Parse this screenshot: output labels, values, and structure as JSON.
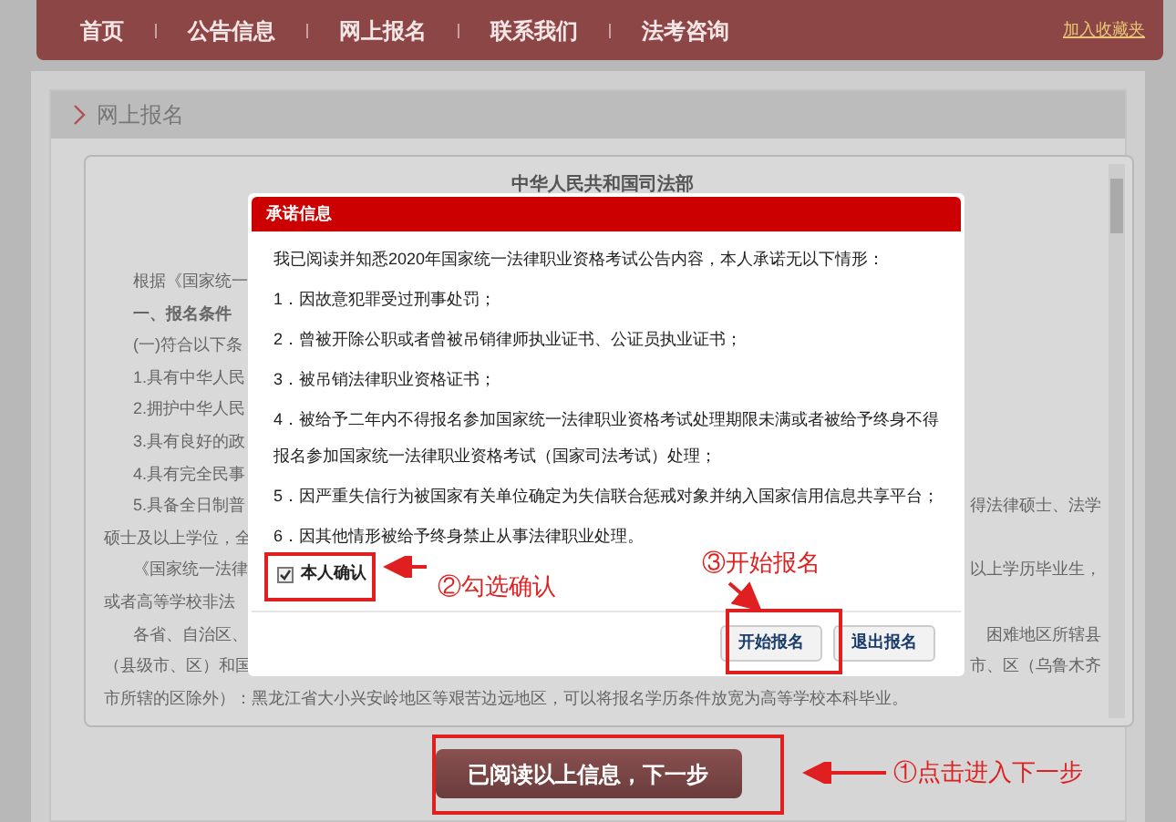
{
  "nav": {
    "items": [
      {
        "label": "首页"
      },
      {
        "label": "公告信息"
      },
      {
        "label": "网上报名"
      },
      {
        "label": "联系我们"
      },
      {
        "label": "法考咨询"
      }
    ],
    "bookmark_link": "加入收藏夹"
  },
  "panel": {
    "title": "网上报名"
  },
  "document": {
    "title": "中华人民共和国司法部",
    "rows": [
      {
        "left": "根据《国家统一",
        "right": "",
        "indent": true,
        "bold": false
      },
      {
        "left": "一、报名条件",
        "right": "",
        "indent": true,
        "bold": true
      },
      {
        "left": "(一)符合以下条",
        "right": "",
        "indent": true,
        "bold": false
      },
      {
        "left": "1.具有中华人民",
        "right": "",
        "indent": true,
        "bold": false
      },
      {
        "left": "2.拥护中华人民",
        "right": "",
        "indent": true,
        "bold": false
      },
      {
        "left": "3.具有良好的政",
        "right": "",
        "indent": true,
        "bold": false
      },
      {
        "left": "4.具有完全民事",
        "right": "",
        "indent": true,
        "bold": false
      },
      {
        "left": "5.具备全日制普",
        "right": "得法律硕士、法学",
        "indent": true,
        "bold": false
      },
      {
        "left": "硕士及以上学位，全",
        "right": "",
        "indent": false,
        "bold": false
      },
      {
        "left": "《国家统一法律",
        "right": "以上学历毕业生，",
        "indent": true,
        "bold": false
      },
      {
        "left": "或者高等学校非法",
        "right": "",
        "indent": false,
        "bold": false
      },
      {
        "left": "各省、自治区、",
        "right": "困难地区所辖县",
        "indent": true,
        "bold": false
      },
      {
        "left": "（县级市、区）和国",
        "right": "市、区（乌鲁木齐",
        "indent": false,
        "bold": false
      },
      {
        "left": "市所辖的区除外）：黑龙江省大小兴安岭地区等艰苦边远地区，可以将报名学历条件放宽为高等学校本科毕业。",
        "right": "",
        "indent": false,
        "bold": false
      }
    ]
  },
  "next_button": "已阅读以上信息，下一步",
  "dialog": {
    "title": "承诺信息",
    "intro": "我已阅读并知悉2020年国家统一法律职业资格考试公告内容，本人承诺无以下情形：",
    "items": [
      "1．因故意犯罪受过刑事处罚；",
      "2．曾被开除公职或者曾被吊销律师执业证书、公证员执业证书；",
      "3．被吊销法律职业资格证书；",
      "4．被给予二年内不得报名参加国家统一法律职业资格考试处理期限未满或者被给予终身不得报名参加国家统一法律职业资格考试（国家司法考试）处理；",
      "5．因严重失信行为被国家有关单位确定为失信联合惩戒对象并纳入国家信用信息共享平台；",
      "6．因其他情形被给予终身禁止从事法律职业处理。"
    ],
    "confirm": {
      "label": "本人确认",
      "checked": true
    },
    "buttons": [
      "开始报名",
      "退出报名"
    ]
  },
  "annotations": {
    "check": "②勾选确认",
    "start": "③开始报名",
    "next": "①点击进入下一步"
  }
}
